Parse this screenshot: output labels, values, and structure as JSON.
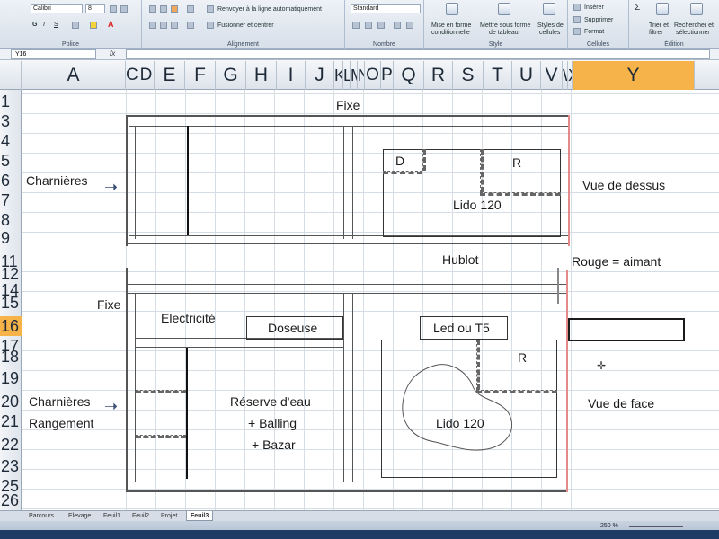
{
  "ribbon": {
    "font_name": "Calibri",
    "font_size": "8",
    "groups": {
      "police": "Police",
      "alignement": "Alignement",
      "nombre": "Nombre",
      "style": "Style",
      "cellules": "Cellules",
      "edition": "Édition"
    },
    "wrap_text": "Renvoyer à la ligne automatiquement",
    "merge_center": "Fusionner et centrer",
    "number_format": "Standard",
    "cond_format_1": "Mise en forme",
    "cond_format_2": "conditionnelle",
    "table_format_1": "Mettre sous forme",
    "table_format_2": "de tableau",
    "cell_styles_1": "Styles de",
    "cell_styles_2": "cellules",
    "insert": "Insérer",
    "delete": "Supprimer",
    "format": "Format",
    "sort_1": "Trier et",
    "sort_2": "filtrer",
    "find_1": "Rechercher et",
    "find_2": "sélectionner"
  },
  "formula_bar": {
    "name_box": "Y16",
    "fx": "fx"
  },
  "columns": [
    "A",
    "C",
    "D",
    "E",
    "F",
    "G",
    "H",
    "I",
    "J",
    "K",
    "L",
    "M",
    "N",
    "O",
    "P",
    "Q",
    "R",
    "S",
    "T",
    "U",
    "V",
    "W",
    "X",
    "Y"
  ],
  "rows": [
    "1",
    "3",
    "4",
    "5",
    "6",
    "7",
    "8",
    "9",
    "11",
    "12",
    "14",
    "15",
    "16",
    "17",
    "18",
    "19",
    "20",
    "21",
    "22",
    "23",
    "25",
    "26"
  ],
  "active_cell": {
    "column": "Y",
    "row": "16"
  },
  "drawing": {
    "top_title": "Fixe",
    "left_hinges_top": "Charnières",
    "d_label": "D",
    "r_label_top": "R",
    "lido_top": "Lido 120",
    "view_top": "Vue de dessus",
    "hublot": "Hublot",
    "red_magnet": "Rouge = aimant",
    "fixe_left": "Fixe",
    "electricite": "Electricité",
    "doseuse": "Doseuse",
    "led": "Led ou T5",
    "r_label_bottom": "R",
    "charnieres_bottom": "Charnières",
    "rangement": "Rangement",
    "reserve_1": "Réserve d'eau",
    "reserve_2": "+ Balling",
    "reserve_3": "+ Bazar",
    "lido_bottom": "Lido 120",
    "view_front": "Vue de face"
  },
  "sheet_tabs": [
    "Parcours",
    "Elevage",
    "Feuil1",
    "Feuil2",
    "Projet",
    "Feuil3"
  ],
  "active_tab": "Feuil3",
  "status": {
    "zoom": "250 %"
  },
  "colors": {
    "active_header": "#f6b349",
    "magnet_line": "#e58a8a"
  }
}
